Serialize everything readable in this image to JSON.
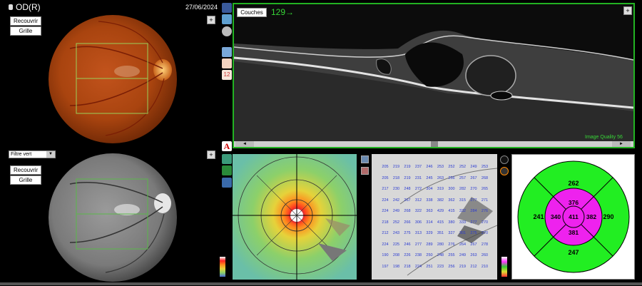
{
  "header": {
    "eye": "OD(R)",
    "date": "27/06/2024"
  },
  "fundus_color": {
    "btn_overlay": "Recouvrir",
    "btn_grid": "Grille"
  },
  "fundus_redfree": {
    "filter": "Filtre vert",
    "btn_overlay": "Recouvrir",
    "btn_grid": "Grille"
  },
  "oct": {
    "layers_btn": "Couches",
    "slice": "129→",
    "quality": "Image Quality 56"
  },
  "side_icons": {
    "a": "A",
    "n12": "12"
  },
  "etdrs": {
    "outer_top": "262",
    "outer_left": "241",
    "outer_right": "290",
    "outer_bottom": "247",
    "inner_top": "376",
    "inner_left": "340",
    "inner_right": "382",
    "inner_bottom": "381",
    "center": "411",
    "outer_color": "#22ee22",
    "inner_color": "#ee22ee"
  },
  "thickness_grid": [
    [
      "205",
      "219",
      "219",
      "237",
      "246",
      "253",
      "252",
      "252",
      "249",
      "253"
    ],
    [
      "205",
      "218",
      "219",
      "231",
      "245",
      "263",
      "256",
      "257",
      "267",
      "268"
    ],
    [
      "217",
      "230",
      "248",
      "272",
      "304",
      "319",
      "300",
      "282",
      "270",
      "265"
    ],
    [
      "224",
      "242",
      "267",
      "312",
      "338",
      "382",
      "362",
      "315",
      "277",
      "271"
    ],
    [
      "224",
      "249",
      "268",
      "322",
      "363",
      "429",
      "415",
      "332",
      "284",
      "276"
    ],
    [
      "218",
      "252",
      "266",
      "306",
      "314",
      "415",
      "380",
      "333",
      "277",
      "270"
    ],
    [
      "212",
      "243",
      "275",
      "313",
      "329",
      "351",
      "327",
      "301",
      "275",
      "270"
    ],
    [
      "224",
      "225",
      "246",
      "277",
      "289",
      "280",
      "276",
      "264",
      "267",
      "278"
    ],
    [
      "190",
      "208",
      "226",
      "238",
      "250",
      "248",
      "255",
      "249",
      "263",
      "260"
    ],
    [
      "197",
      "198",
      "218",
      "224",
      "251",
      "223",
      "256",
      "219",
      "212",
      "210"
    ]
  ]
}
